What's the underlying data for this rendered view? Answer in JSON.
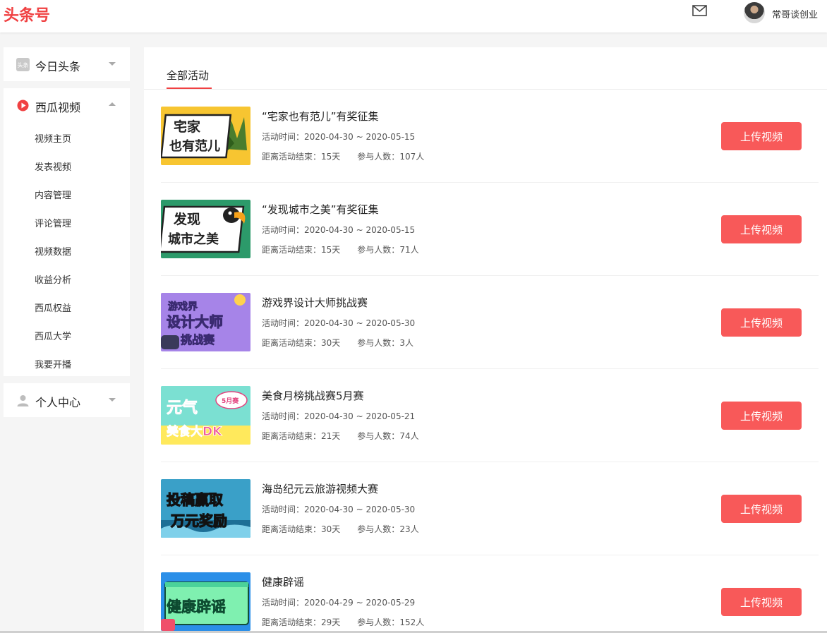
{
  "header": {
    "logo": "头条号",
    "username": "常哥谈创业"
  },
  "sidebar": {
    "toutiao": {
      "label": "今日头条",
      "badge": "头条"
    },
    "xigua": {
      "label": "西瓜视频",
      "items": [
        "视频主页",
        "发表视频",
        "内容管理",
        "评论管理",
        "视频数据",
        "收益分析",
        "西瓜权益",
        "西瓜大学",
        "我要开播"
      ]
    },
    "personal": {
      "label": "个人中心"
    }
  },
  "main": {
    "tab": "全部活动",
    "upload_label": "上传视频",
    "time_label": "活动时间：",
    "remain_label": "距离活动结束：",
    "people_label": "参与人数：",
    "activities": [
      {
        "title": "“宅家也有范儿”有奖征集",
        "time": "2020-04-30 ~ 2020-05-15",
        "remain": "15天",
        "people": "107人",
        "thumb_lines": [
          "宅家",
          "也有范儿"
        ]
      },
      {
        "title": "“发现城市之美”有奖征集",
        "time": "2020-04-30 ~ 2020-05-15",
        "remain": "15天",
        "people": "71人",
        "thumb_lines": [
          "发现",
          "城市之美"
        ]
      },
      {
        "title": "游戏界设计大师挑战赛",
        "time": "2020-04-30 ~ 2020-05-30",
        "remain": "30天",
        "people": "3人",
        "thumb_lines": [
          "游戏界",
          "设计大师",
          "挑战赛"
        ]
      },
      {
        "title": "美食月榜挑战赛5月赛",
        "time": "2020-04-30 ~ 2020-05-21",
        "remain": "21天",
        "people": "74人",
        "thumb_lines": [
          "元气",
          "美食大DK",
          "5月赛"
        ]
      },
      {
        "title": "海岛纪元云旅游视频大赛",
        "time": "2020-04-30 ~ 2020-05-30",
        "remain": "30天",
        "people": "23人",
        "thumb_lines": [
          "投稿赢取",
          "万元奖励"
        ]
      },
      {
        "title": "健康辟谣",
        "time": "2020-04-29 ~ 2020-05-29",
        "remain": "29天",
        "people": "152人",
        "thumb_lines": [
          "健康辟谣"
        ]
      }
    ]
  },
  "colors": {
    "brand": "#f04142",
    "button": "#f85959"
  }
}
